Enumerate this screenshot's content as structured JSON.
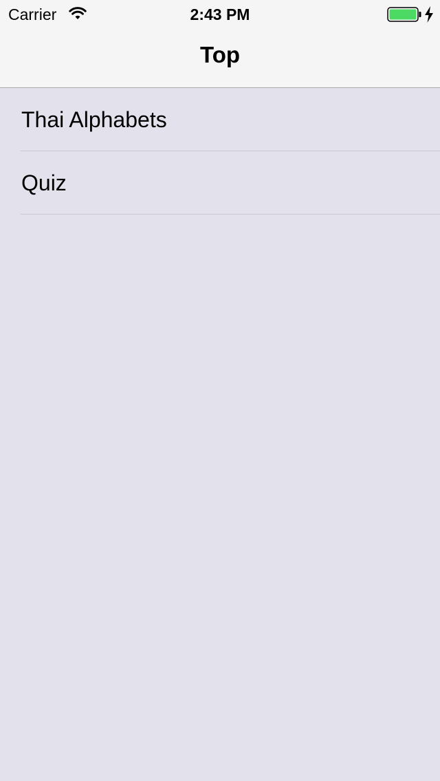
{
  "status_bar": {
    "carrier": "Carrier",
    "time": "2:43 PM",
    "battery_color": "#4cd964",
    "icons": [
      "wifi-icon",
      "battery-icon",
      "charging-icon"
    ]
  },
  "nav": {
    "title": "Top"
  },
  "list": {
    "items": [
      {
        "label": "Thai Alphabets"
      },
      {
        "label": "Quiz"
      }
    ]
  },
  "colors": {
    "background": "#e3e1ec",
    "nav_bar": "#f5f5f5"
  }
}
